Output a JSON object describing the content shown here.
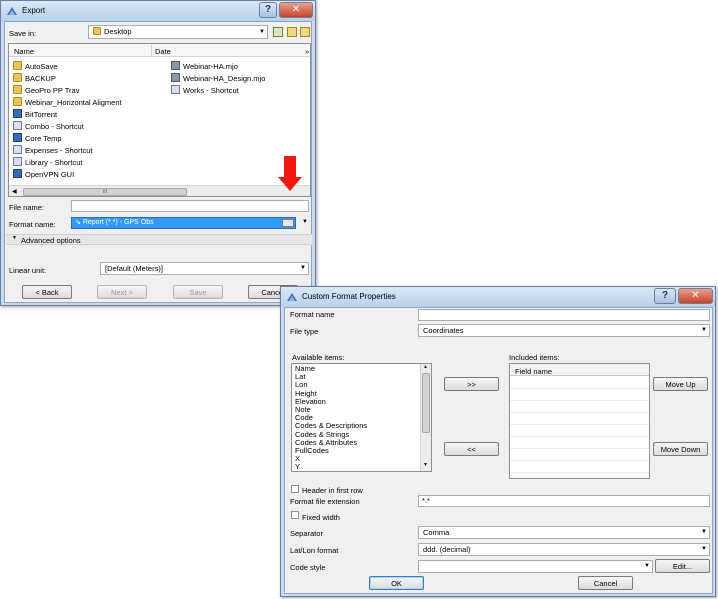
{
  "export": {
    "title": "Export",
    "save_in_label": "Save in:",
    "save_in_value": "Desktop",
    "columns": {
      "name": "Name",
      "date": "Date"
    },
    "files_col1": [
      {
        "name": "AutoSave",
        "icon": "folder-icon"
      },
      {
        "name": "BACKUP",
        "icon": "folder-icon"
      },
      {
        "name": "GeoPro PP Trav",
        "icon": "folder-icon"
      },
      {
        "name": "Webinar_Horizontal Aligment",
        "icon": "folder-icon"
      },
      {
        "name": "BitTorrent",
        "icon": "app-icon"
      },
      {
        "name": "Combo - Shortcut",
        "icon": "shortcut-icon"
      },
      {
        "name": "Core Temp",
        "icon": "app-icon"
      },
      {
        "name": "Expenses - Shortcut",
        "icon": "shortcut-icon"
      },
      {
        "name": "Library - Shortcut",
        "icon": "shortcut-icon"
      },
      {
        "name": "OpenVPN GUI",
        "icon": "app-icon"
      }
    ],
    "files_col2": [
      {
        "name": "Webinar-HA.mjo",
        "icon": "document-icon"
      },
      {
        "name": "Webinar-HA_Design.mjo",
        "icon": "document-icon"
      },
      {
        "name": "Works - Shortcut",
        "icon": "shortcut-icon"
      }
    ],
    "file_name_label": "File name:",
    "file_name_value": "",
    "format_name_label": "Format name:",
    "format_name_value": "Report (*.*) - GPS Obs",
    "advanced_options": "Advanced options",
    "linear_unit_label": "Linear unit:",
    "linear_unit_value": "[Default (Meters)]",
    "buttons": {
      "back": "< Back",
      "next": "Next >",
      "save": "Save",
      "cancel": "Cancel"
    },
    "scroll_thumb_glyph": "III"
  },
  "cfp": {
    "title": "Custom Format Properties",
    "format_name_label": "Format name",
    "format_name_value": "",
    "file_type_label": "File type",
    "file_type_value": "Coordinates",
    "available_label": "Available items:",
    "available_items": [
      "Name",
      "Lat",
      "Lon",
      "Height",
      "Elevation",
      "Note",
      "Code",
      "Codes & Descriptions",
      "Codes & Strings",
      "Codes & Attributes",
      "FullCodes",
      "X",
      "Y"
    ],
    "included_label": "Included items:",
    "field_name_header": "Field name",
    "add_button": ">>",
    "remove_button": "<<",
    "move_up": "Move Up",
    "move_down": "Move Down",
    "header_first_row": "Header in first row",
    "format_ext_label": "Format file extension",
    "format_ext_value": "*.*",
    "fixed_width": "Fixed width",
    "separator_label": "Separator",
    "separator_value": "Comma",
    "latlon_label": "Lat/Lon format",
    "latlon_value": "ddd. (decimal)",
    "code_style_label": "Code style",
    "code_style_value": "",
    "edit_button": "Edit...",
    "ok_button": "OK",
    "cancel_button": "Cancel"
  },
  "colors": {
    "highlight": "#3399ff",
    "annotation_arrow": "#ef1b10",
    "window_frame": "#c9daf0"
  }
}
